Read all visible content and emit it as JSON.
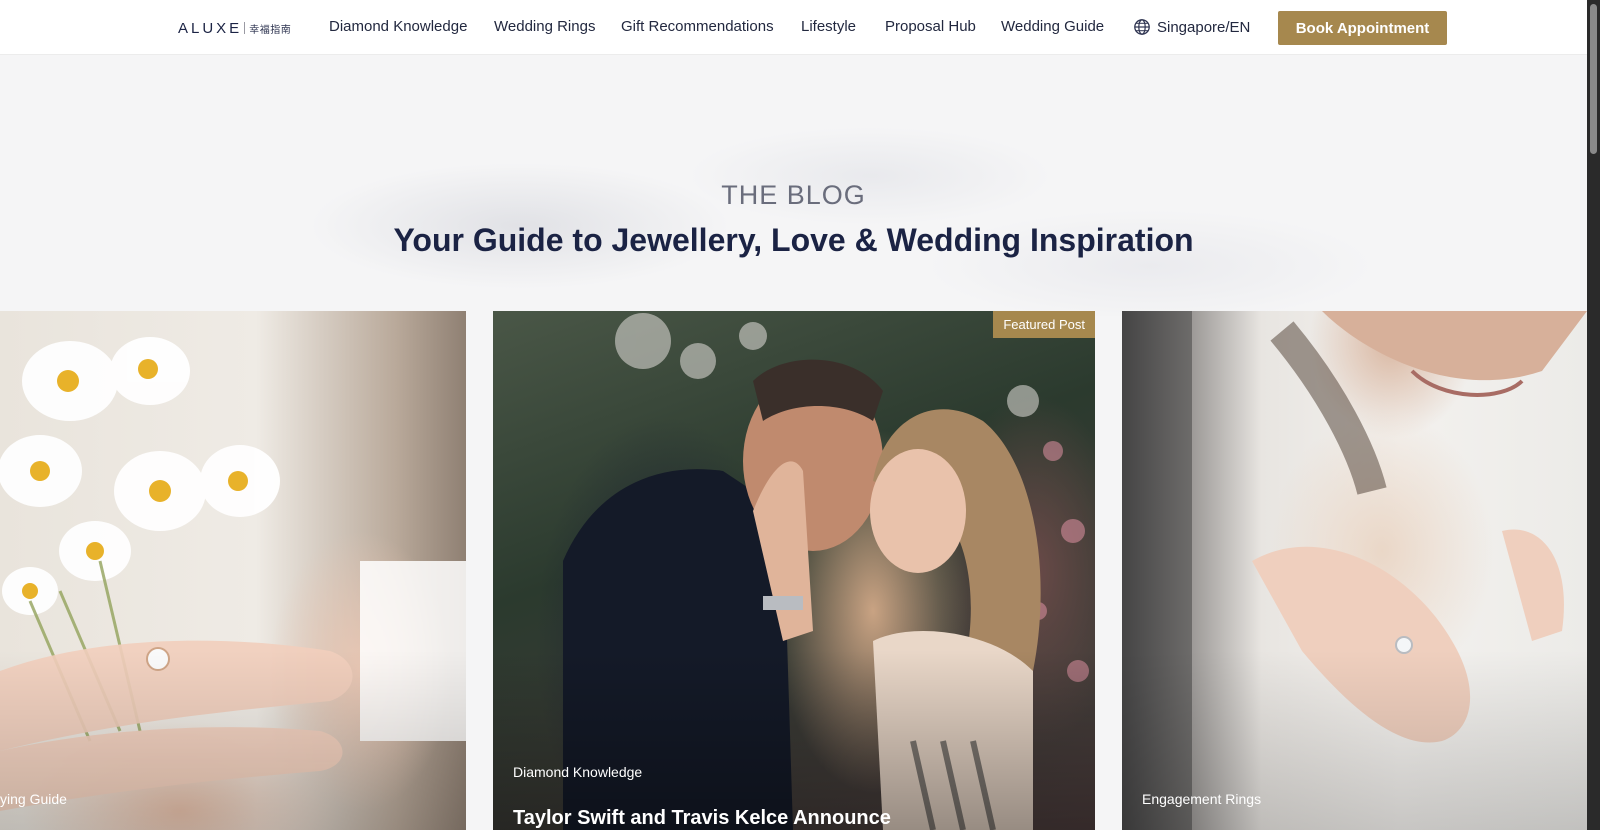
{
  "header": {
    "logo": {
      "word": "ALUXE",
      "cn": "幸福指南"
    },
    "nav": [
      {
        "label": "Diamond Knowledge"
      },
      {
        "label": "Wedding Rings"
      },
      {
        "label": "Gift Recommendations"
      },
      {
        "label": "Lifestyle"
      },
      {
        "label": "Proposal Hub"
      },
      {
        "label": "Wedding Guide"
      }
    ],
    "region": {
      "label": "Singapore/EN",
      "icon": "globe-icon"
    },
    "cta": {
      "label": "Book Appointment",
      "color": "#a6884e"
    }
  },
  "hero": {
    "eyebrow": "THE BLOG",
    "headline": "Your Guide to Jewellery, Love & Wedding Inspiration"
  },
  "cards": [
    {
      "category": "ying Guide"
    },
    {
      "badge": "Featured Post",
      "category": "Diamond Knowledge",
      "title": "Taylor Swift and Travis Kelce Announce"
    },
    {
      "category": "Engagement Rings"
    }
  ],
  "colors": {
    "accent": "#a6884e",
    "navy": "#1b2344",
    "background": "#f5f5f6"
  }
}
